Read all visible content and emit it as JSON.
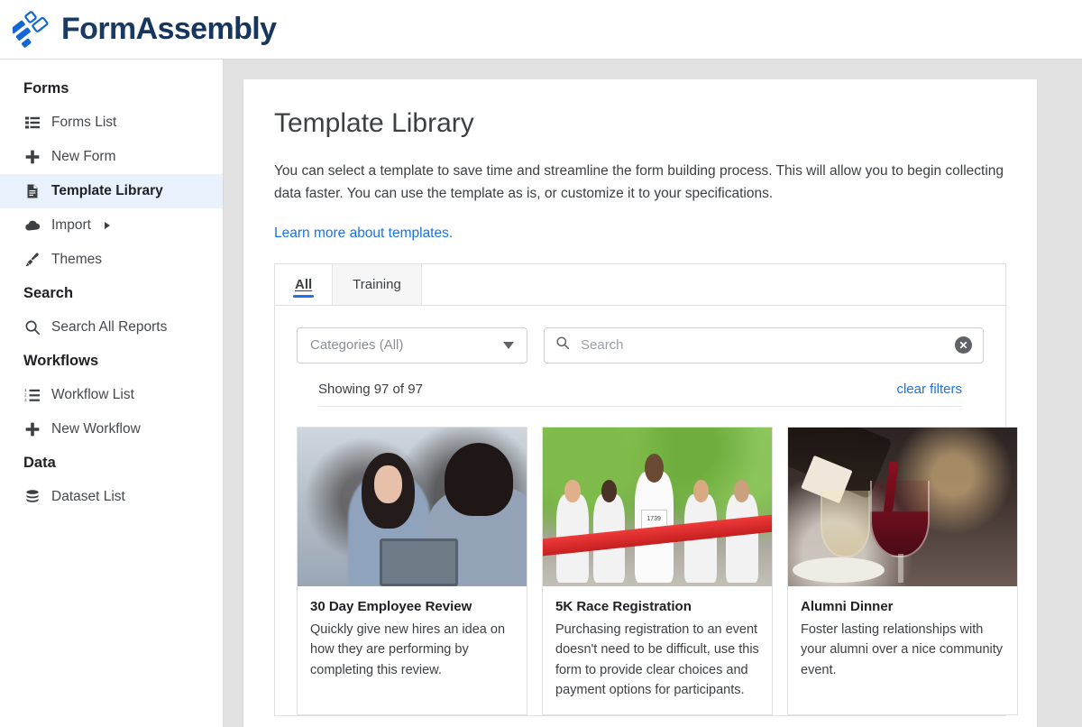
{
  "brand": {
    "name_part1": "Form",
    "name_part2": "Assembly",
    "logo_icon": "formassembly-logo-icon",
    "accent_color": "#1a73e8",
    "wordmark_color": "#17365d"
  },
  "sidebar": {
    "groups": [
      {
        "title": "Forms",
        "items": [
          {
            "label": "Forms List",
            "icon": "list-icon",
            "active": false,
            "has_submenu": false
          },
          {
            "label": "New Form",
            "icon": "plus-icon",
            "active": false,
            "has_submenu": false
          },
          {
            "label": "Template Library",
            "icon": "document-icon",
            "active": true,
            "has_submenu": false
          },
          {
            "label": "Import",
            "icon": "cloud-upload-icon",
            "active": false,
            "has_submenu": true
          },
          {
            "label": "Themes",
            "icon": "paintbrush-icon",
            "active": false,
            "has_submenu": false
          }
        ]
      },
      {
        "title": "Search",
        "items": [
          {
            "label": "Search All Reports",
            "icon": "search-icon",
            "active": false,
            "has_submenu": false
          }
        ]
      },
      {
        "title": "Workflows",
        "items": [
          {
            "label": "Workflow List",
            "icon": "ordered-list-icon",
            "active": false,
            "has_submenu": false
          },
          {
            "label": "New Workflow",
            "icon": "plus-icon",
            "active": false,
            "has_submenu": false
          }
        ]
      },
      {
        "title": "Data",
        "items": [
          {
            "label": "Dataset List",
            "icon": "database-icon",
            "active": false,
            "has_submenu": false
          }
        ]
      }
    ]
  },
  "main": {
    "page_title": "Template Library",
    "intro": "You can select a template to save time and streamline the form building process. This will allow you to begin collecting data faster. You can use the template as is, or customize it to your specifications.",
    "learn_more_link": "Learn more about templates.",
    "tabs": [
      {
        "label": "All",
        "active": true
      },
      {
        "label": "Training",
        "active": false
      }
    ],
    "category_filter": {
      "selected_label": "Categories (All)",
      "icon": "chevron-down-icon"
    },
    "search": {
      "placeholder": "Search",
      "value": "",
      "search_icon": "search-icon",
      "clear_icon": "clear-circle-icon"
    },
    "results_count_text": "Showing 97 of 97",
    "clear_filters_label": "clear filters",
    "templates": [
      {
        "title": "30 Day Employee Review",
        "description": "Quickly give new hires an idea on how they are performing by completing this review.",
        "thumbnail": "two-people-meeting-at-desk-photo"
      },
      {
        "title": "5K Race Registration",
        "description": "Purchasing registration to an event doesn't need to be difficult, use this form to provide clear choices and payment options for participants.",
        "thumbnail": "runners-crossing-finish-line-photo",
        "thumbnail_detail": {
          "bib_number": "1739"
        }
      },
      {
        "title": "Alumni Dinner",
        "description": "Foster lasting relationships with your alumni over a nice community event.",
        "thumbnail": "pouring-red-wine-at-dinner-photo"
      }
    ]
  }
}
